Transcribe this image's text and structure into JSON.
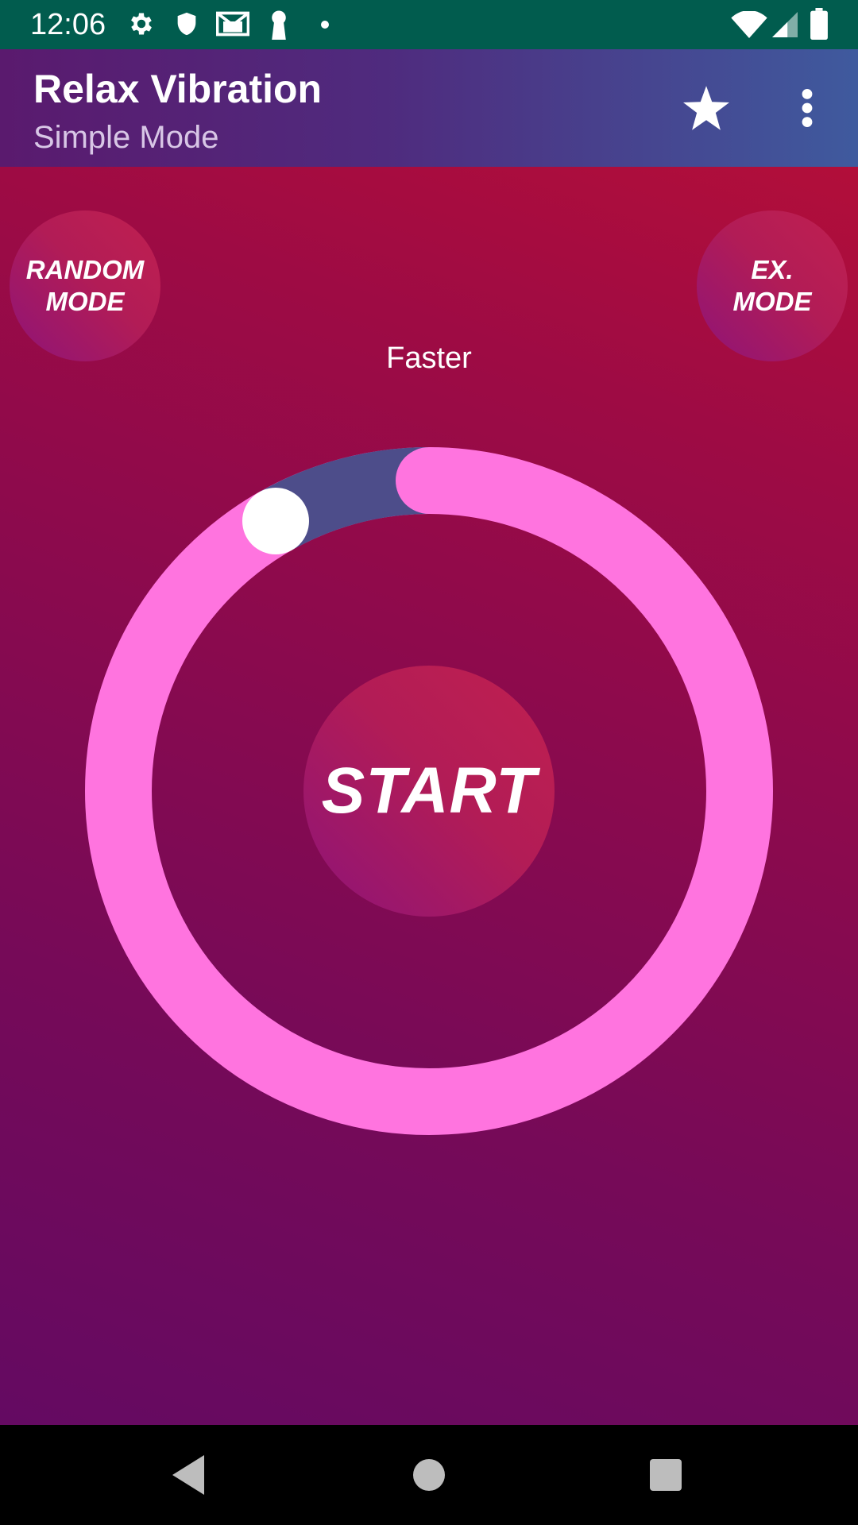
{
  "status_bar": {
    "time": "12:06",
    "icons_left": [
      "settings-icon",
      "shield-icon",
      "gmail-icon",
      "keyhole-icon",
      "dot-icon"
    ],
    "icons_right": [
      "wifi-icon",
      "cell-signal-icon",
      "battery-icon"
    ],
    "background": "#015c4e"
  },
  "app_bar": {
    "title": "Relax Vibration",
    "subtitle": "Simple Mode",
    "actions": [
      "star-icon",
      "more-vert-icon"
    ]
  },
  "main": {
    "random_mode_label": "RANDOM\nMODE",
    "ex_mode_label": "EX.\nMODE",
    "speed_label": "Faster",
    "start_label": "START",
    "dial": {
      "track_color": "#ff74df",
      "progress_color": "#4d4d8a",
      "knob_color": "#ffffff",
      "level_fraction": 0.11
    }
  },
  "nav_bar": {
    "buttons": [
      "back-icon",
      "home-icon",
      "recents-icon"
    ]
  }
}
